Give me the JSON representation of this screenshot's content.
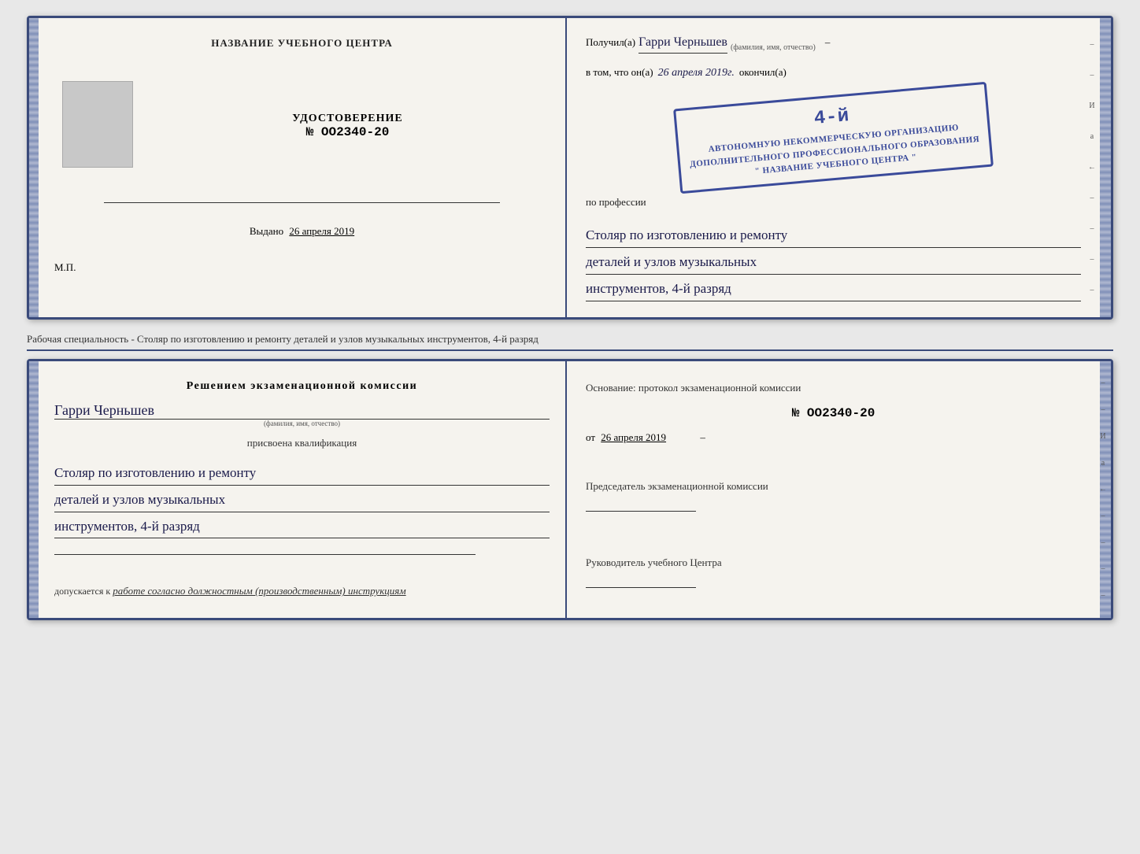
{
  "top_booklet": {
    "left": {
      "title": "НАЗВАНИЕ УЧЕБНОГО ЦЕНТРА",
      "udost_label": "УДОСТОВЕРЕНИЕ",
      "udost_number": "№ OO2340-20",
      "vydano_label": "Выдано",
      "vydano_date": "26 апреля 2019",
      "mp_label": "М.П."
    },
    "right": {
      "poluchil_label": "Получил(а)",
      "recipient_name": "Гарри Черньшев",
      "fio_caption": "(фамилия, имя, отчество)",
      "vtom_label": "в том, что он(а)",
      "date_value": "26 апреля 2019г.",
      "okonchil_label": "окончил(а)",
      "stamp_line1": "АВТОНОМНУЮ НЕКОММЕРЧЕСКУЮ ОРГАНИЗАЦИЮ",
      "stamp_line2": "ДОПОЛНИТЕЛЬНОГО ПРОФЕССИОНАЛЬНОГО ОБРАЗОВАНИЯ",
      "stamp_line3": "\" НАЗВАНИЕ УЧЕБНОГО ЦЕНТРА \"",
      "stamp_number": "4-й",
      "po_professii_label": "по профессии",
      "profession_line1": "Столяр по изготовлению и ремонту",
      "profession_line2": "деталей и узлов музыкальных",
      "profession_line3": "инструментов, 4-й разряд"
    }
  },
  "separator": {
    "text": "Рабочая специальность - Столяр по изготовлению и ремонту деталей и узлов музыкальных инструментов, 4-й разряд"
  },
  "bottom_booklet": {
    "left": {
      "reshenie_title": "Решением  экзаменационной  комиссии",
      "name_handwritten": "Гарри Черньшев",
      "fio_caption": "(фамилия, имя, отчество)",
      "prisvoena_label": "присвоена квалификация",
      "qualification_line1": "Столяр по изготовлению и ремонту",
      "qualification_line2": "деталей и узлов музыкальных",
      "qualification_line3": "инструментов, 4-й разряд",
      "dopuskaetsya_label": "допускается к",
      "dopuskaetsya_value": "работе согласно должностным (производственным) инструкциям"
    },
    "right": {
      "osnov_label": "Основание: протокол экзаменационной комиссии",
      "protocol_number": "№ OO2340-20",
      "ot_label": "от",
      "ot_date": "26 апреля 2019",
      "predsedatel_label": "Председатель экзаменационной комиссии",
      "rukovoditel_label": "Руководитель учебного Центра"
    }
  },
  "edge_marks": {
    "marks": [
      "–",
      "–",
      "И",
      "а",
      "←",
      "–",
      "–",
      "–",
      "–"
    ]
  }
}
